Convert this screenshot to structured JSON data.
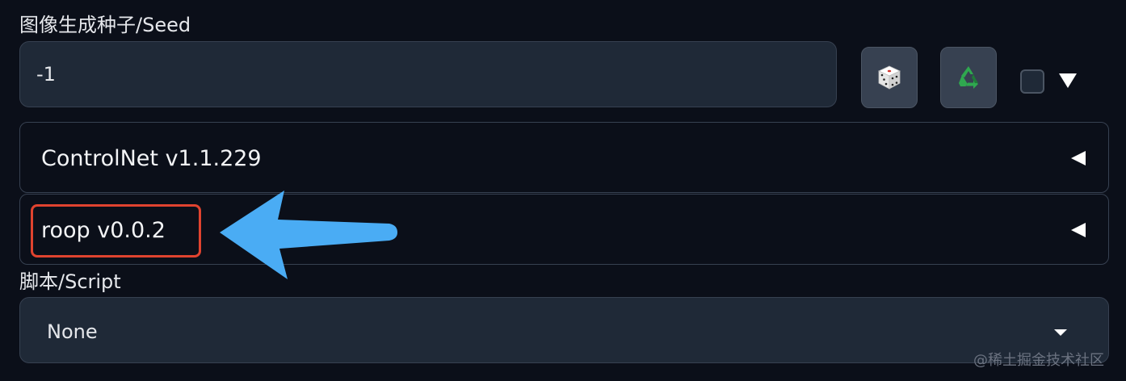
{
  "seed": {
    "label": "图像生成种子/Seed",
    "value": "-1",
    "random_button_icon": "dice-icon",
    "reuse_button_icon": "recycle-icon"
  },
  "accordions": [
    {
      "title": "ControlNet v1.1.229",
      "state": "collapsed"
    },
    {
      "title": "roop v0.0.2",
      "state": "collapsed",
      "highlighted": true
    }
  ],
  "script": {
    "label": "脚本/Script",
    "selected": "None"
  },
  "annotation": {
    "arrow_color": "#4aacf4",
    "box_color": "#e0432f"
  },
  "watermark": "@稀土掘金技术社区"
}
